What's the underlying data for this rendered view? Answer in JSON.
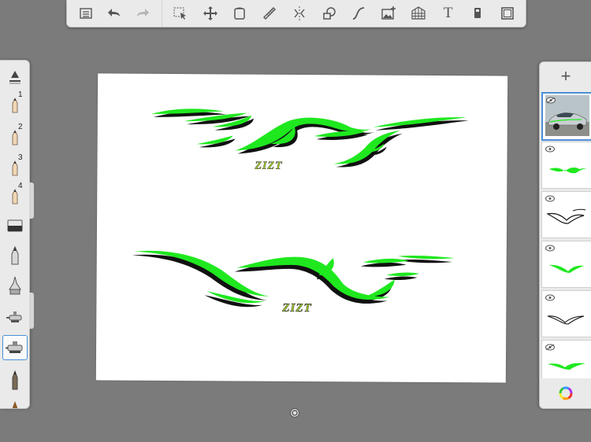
{
  "colors": {
    "background": "#7b7b7b",
    "accent": "#4a90d9",
    "stripe_green": "#1fe81f",
    "stripe_shadow": "#111111",
    "text_lime": "#a5d22a"
  },
  "top_toolbar": {
    "tools": [
      {
        "name": "menu-icon",
        "label": ""
      },
      {
        "name": "undo-icon",
        "label": ""
      },
      {
        "name": "redo-icon",
        "label": ""
      },
      {
        "name": "selection-icon",
        "label": ""
      },
      {
        "name": "transform-icon",
        "label": ""
      },
      {
        "name": "crop-icon",
        "label": ""
      },
      {
        "name": "ruler-icon",
        "label": ""
      },
      {
        "name": "symmetry-icon",
        "label": ""
      },
      {
        "name": "shapes-icon",
        "label": ""
      },
      {
        "name": "curve-icon",
        "label": ""
      },
      {
        "name": "add-image-icon",
        "label": ""
      },
      {
        "name": "perspective-icon",
        "label": ""
      },
      {
        "name": "text-icon",
        "label": "T"
      },
      {
        "name": "marker-icon",
        "label": ""
      },
      {
        "name": "fullscreen-icon",
        "label": ""
      }
    ]
  },
  "left_toolbar": {
    "brushes": [
      {
        "name": "brush-settings-icon",
        "number": ""
      },
      {
        "name": "pencil-icon",
        "number": "1"
      },
      {
        "name": "pencil-icon",
        "number": "2"
      },
      {
        "name": "pencil-icon",
        "number": "3"
      },
      {
        "name": "pencil-icon",
        "number": "4"
      },
      {
        "name": "eraser-icon",
        "number": ""
      },
      {
        "name": "pen-icon",
        "number": ""
      },
      {
        "name": "ink-pen-icon",
        "number": ""
      },
      {
        "name": "airbrush-icon",
        "number": ""
      },
      {
        "name": "airbrush-wide-icon",
        "number": ""
      },
      {
        "name": "marker-brush-icon",
        "number": ""
      },
      {
        "name": "brush-icon",
        "number": ""
      }
    ],
    "active_index": 9
  },
  "canvas": {
    "upper_text": "ZIZT",
    "lower_text": "ZIZT"
  },
  "layers_panel": {
    "add_label": "+",
    "layers": [
      {
        "name": "photo-layer",
        "visible": false,
        "selected": true
      },
      {
        "name": "green-stripes-layer",
        "visible": true,
        "selected": false
      },
      {
        "name": "black-outline-layer",
        "visible": true,
        "selected": false
      },
      {
        "name": "green-stripes-small-layer",
        "visible": true,
        "selected": false
      },
      {
        "name": "black-outline-small-layer",
        "visible": true,
        "selected": false
      },
      {
        "name": "green-partial-layer",
        "visible": false,
        "selected": false
      }
    ]
  }
}
